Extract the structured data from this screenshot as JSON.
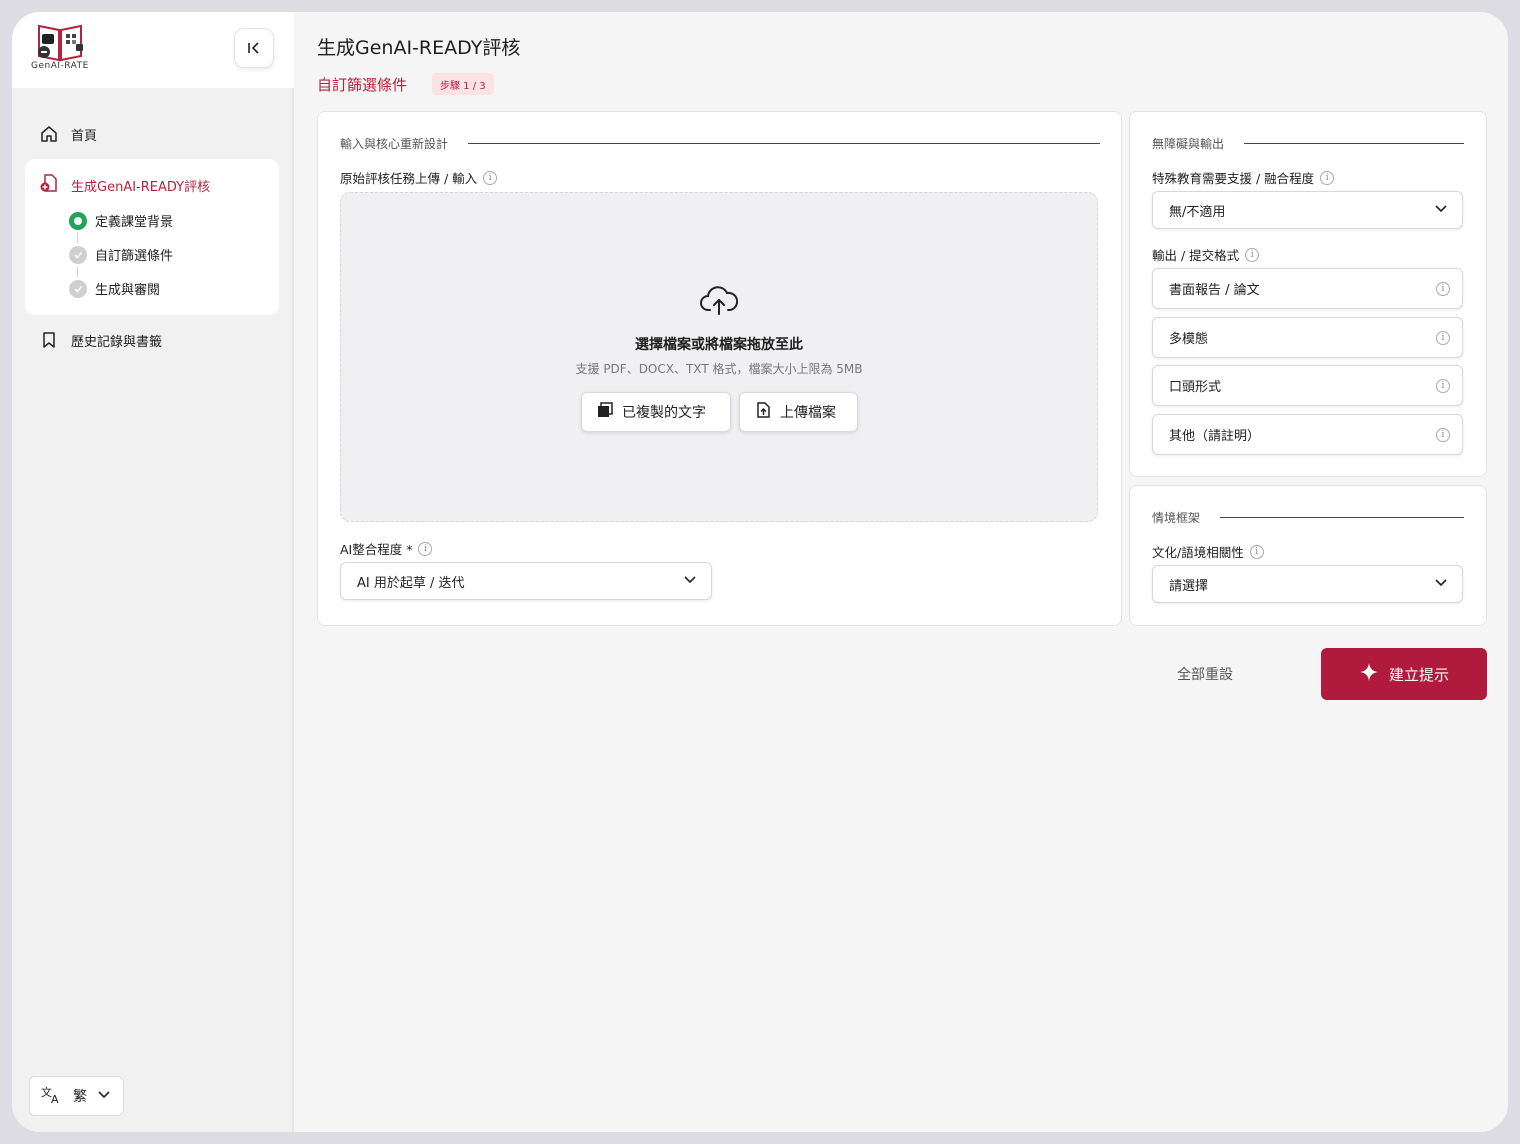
{
  "brand": {
    "logo_text": "GenAI-RATE"
  },
  "sidebar": {
    "home_label": "首頁",
    "active_label": "生成GenAI-READY評核",
    "steps": [
      "定義課堂背景",
      "自訂篩選條件",
      "生成與審閱"
    ],
    "history_label": "歷史記錄與書籤",
    "language_label": "繁"
  },
  "header": {
    "title": "生成GenAI-READY評核",
    "subtitle": "自訂篩選條件",
    "step_badge": "步驟 1 / 3"
  },
  "input_card": {
    "section_title": "輸入與核心重新設計",
    "upload_label": "原始評核任務上傳 / 輸入",
    "dropzone_title": "選擇檔案或將檔案拖放至此",
    "dropzone_hint": "支援 PDF、DOCX、TXT 格式，檔案大小上限為 5MB",
    "copied_text_button": "已複製的文字",
    "upload_button": "上傳檔案",
    "ai_level_label": "AI整合程度 *",
    "ai_level_value": "AI 用於起草 / 迭代"
  },
  "accessibility_card": {
    "section_title": "無障礙與輸出",
    "sen_label": "特殊教育需要支援 / 融合程度",
    "sen_value": "無/不適用",
    "format_label": "輸出 / 提交格式",
    "format_options": [
      "書面報告 / 論文",
      "多模態",
      "口頭形式",
      "其他（請註明）"
    ]
  },
  "context_card": {
    "section_title": "情境框架",
    "relevance_label": "文化/語境相關性",
    "relevance_value": "請選擇"
  },
  "actions": {
    "reset_label": "全部重設",
    "create_label": "建立提示"
  },
  "colors": {
    "accent": "#b01a3c",
    "done": "#22a35a"
  }
}
